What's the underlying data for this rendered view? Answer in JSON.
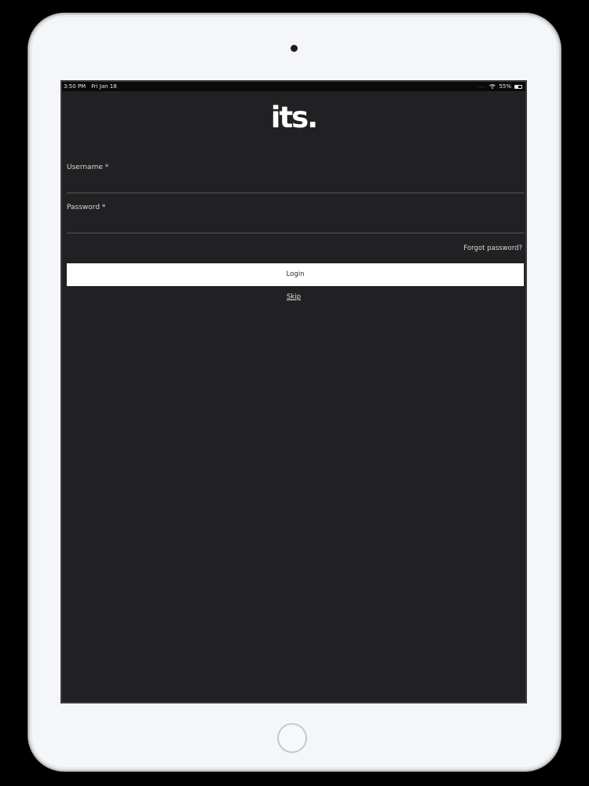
{
  "status_bar": {
    "time": "3:50 PM",
    "date": "Fri Jan 18",
    "signal": "....",
    "battery_percent": "55%",
    "battery_level": 0.55
  },
  "logo": {
    "text": "its."
  },
  "form": {
    "username_label": "Username *",
    "username_value": "",
    "password_label": "Password *",
    "password_value": "",
    "forgot_password": "Forgot password?",
    "login_button": "Login",
    "skip_link": "Skip"
  },
  "icons": {
    "wifi": "wifi-icon",
    "battery": "battery-icon",
    "camera": "front-camera",
    "home": "home-button"
  },
  "colors": {
    "screen_background": "#212123",
    "button_background": "#ffffff",
    "device_frame": "#f5f6f8"
  }
}
